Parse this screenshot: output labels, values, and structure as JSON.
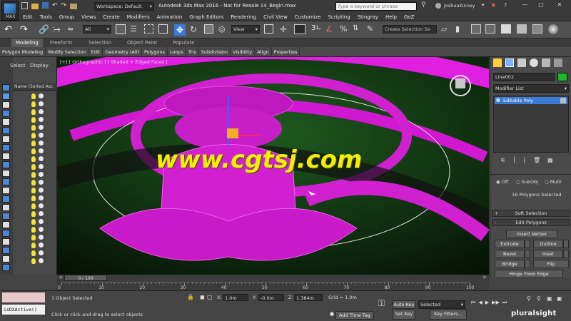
{
  "app": {
    "window_title": "Autodesk 3ds Max 2016 - Not for Resale   14_Begin.max",
    "workspace_label": "Workspace: Default",
    "search_placeholder": "Type a keyword or phrase",
    "user_name": "JoshuaKinney",
    "max_logo": "MAX"
  },
  "menu": [
    "Edit",
    "Tools",
    "Group",
    "Views",
    "Create",
    "Modifiers",
    "Animation",
    "Graph Editors",
    "Rendering",
    "Civil View",
    "Customize",
    "Scripting",
    "Stingray",
    "Help",
    "GoZ"
  ],
  "toolbar": {
    "filter_value": "All",
    "view_value": "View",
    "selection_set_placeholder": "Create Selection Se",
    "count_label": "3"
  },
  "ribbon": {
    "tabs": [
      "Modeling",
      "Freeform",
      "Selection",
      "Object Paint",
      "Populate"
    ],
    "sub_tabs": [
      "Polygon Modeling",
      "Modify Selection",
      "Edit",
      "Geometry (All)",
      "Polygons",
      "Loops",
      "Tris",
      "Subdivision",
      "Visibility",
      "Align",
      "Properties"
    ]
  },
  "scene_explorer": {
    "tabs": [
      "Select",
      "Display"
    ],
    "column_header": "Name (Sorted Asc"
  },
  "viewport": {
    "label": "[+] [ Orthographic ] [ Shaded + Edged Faces ]",
    "watermark": "www.cgtsj.com"
  },
  "command_panel": {
    "object_name": "Line002",
    "modifier_list_label": "Modifier List",
    "stack_item": "Editable Poly",
    "selection_radio": [
      "Off",
      "SubObj",
      "Multi"
    ],
    "selection_status": "16 Polygons Selected",
    "rollouts": [
      "Soft Selection",
      "Edit Polygons"
    ],
    "edit_buttons": {
      "insert_vertex": "Insert Vertex",
      "extrude": "Extrude",
      "outline": "Outline",
      "bevel": "Bevel",
      "inset": "Inset",
      "bridge": "Bridge",
      "flip": "Flip",
      "hinge_from_edge": "Hinge From Edge",
      "extrude_along_spline": "Extrude Along Spline",
      "edit_triangulation": "Edit Triangulation"
    }
  },
  "timeline": {
    "frame_indicator": "0 / 100",
    "ticks": [
      "0",
      "10",
      "20",
      "30",
      "40",
      "50",
      "60",
      "70",
      "80",
      "90",
      "100"
    ]
  },
  "status": {
    "maxscript_listener": "isDXActive()",
    "selection_info": "1 Object Selected",
    "prompt": "Click or click-and-drag to select objects",
    "x_label": "X:",
    "x_value": "1.0m",
    "y_label": "Y:",
    "y_value": "-0.0m",
    "z_label": "Z:",
    "z_value": "1.384m",
    "grid_value": "Grid = 1.0m",
    "add_time_tag": "Add Time Tag",
    "auto_key": "Auto Key",
    "set_key": "Set Key",
    "selected_value": "Selected",
    "key_filters": "Key Filters...",
    "brand": "pluralsight"
  },
  "colors": {
    "mesh": "#d020d0",
    "watermark": "#f0f000",
    "accent_blue": "#3a7bd5"
  }
}
